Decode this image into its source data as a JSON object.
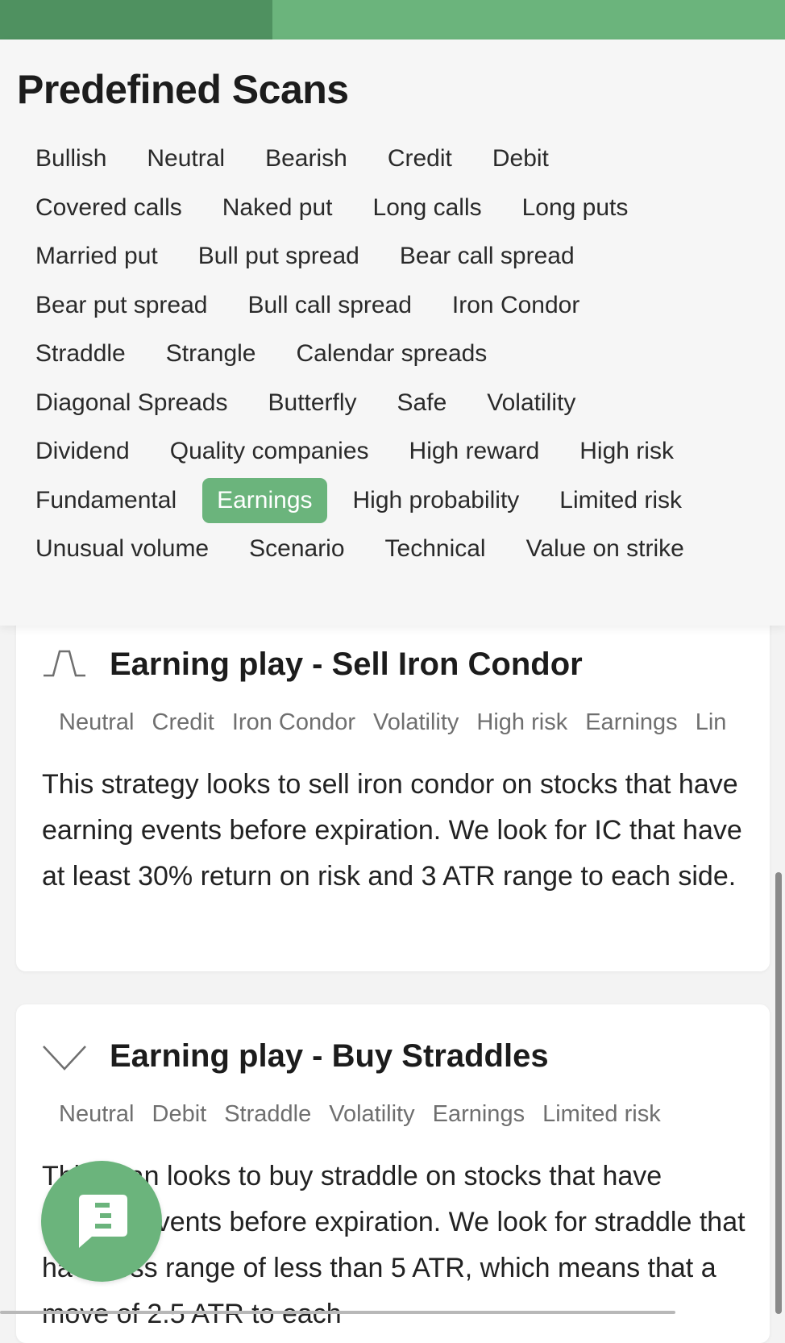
{
  "colors": {
    "accent": "#6bb47c",
    "accent_dark": "#4f9160"
  },
  "scans": {
    "title": "Predefined Scans",
    "rows": [
      [
        "Bullish",
        "Neutral",
        "Bearish",
        "Credit",
        "Debit"
      ],
      [
        "Covered calls",
        "Naked put",
        "Long calls",
        "Long puts"
      ],
      [
        "Married put",
        "Bull put spread",
        "Bear call spread"
      ],
      [
        "Bear put spread",
        "Bull call spread",
        "Iron Condor"
      ],
      [
        "Straddle",
        "Strangle",
        "Calendar spreads"
      ],
      [
        "Diagonal Spreads",
        "Butterfly",
        "Safe",
        "Volatility"
      ],
      [
        "Dividend",
        "Quality companies",
        "High reward",
        "High risk"
      ],
      [
        "Fundamental",
        "Earnings",
        "High probability",
        "Limited risk"
      ],
      [
        "Unusual volume",
        "Scenario",
        "Technical",
        "Value on strike"
      ]
    ],
    "selected": "Earnings"
  },
  "cards": [
    {
      "icon": "iron-condor-payoff-icon",
      "title": "Earning play - Sell Iron Condor",
      "tags": [
        "Neutral",
        "Credit",
        "Iron Condor",
        "Volatility",
        "High risk",
        "Earnings",
        "Lin"
      ],
      "description": "This strategy looks to sell iron condor on stocks that have earning events before expiration. We look for IC that have at least 30% return on risk and 3 ATR range to each side."
    },
    {
      "icon": "straddle-payoff-icon",
      "title": "Earning play - Buy Straddles",
      "tags": [
        "Neutral",
        "Debit",
        "Straddle",
        "Volatility",
        "Earnings",
        "Limited risk"
      ],
      "description": "This scan looks to buy straddle on stocks that have earning events before expiration. We look for straddle that have loss range of less than 5 ATR, which means that a move of 2.5 ATR to each"
    }
  ],
  "fab": {
    "icon": "chat-icon"
  }
}
